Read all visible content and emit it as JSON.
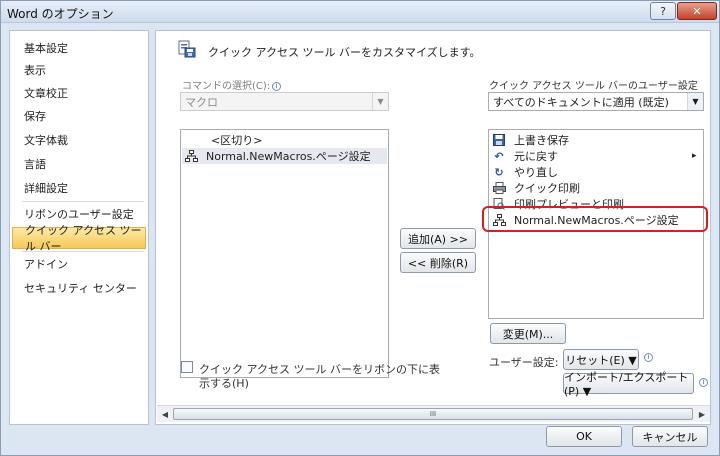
{
  "window": {
    "title": "Word のオプション",
    "help_button": "?",
    "close_button": "✕"
  },
  "nav": {
    "items": [
      {
        "label": "基本設定"
      },
      {
        "label": "表示"
      },
      {
        "label": "文章校正"
      },
      {
        "label": "保存"
      },
      {
        "label": "文字体裁"
      },
      {
        "label": "言語"
      },
      {
        "label": "詳細設定"
      },
      {
        "label": "リボンのユーザー設定"
      },
      {
        "label": "クイック アクセス ツール バー",
        "selected": true
      },
      {
        "label": "アドイン"
      },
      {
        "label": "セキュリティ センター"
      }
    ]
  },
  "main": {
    "header": "クイック アクセス ツール バーをカスタマイズします。",
    "choose_commands_label": "コマンドの選択(C):",
    "choose_commands_value": "マクロ",
    "qat_customize_label": "クイック アクセス ツール バーのユーザー設定(Q):",
    "qat_customize_value": "すべてのドキュメントに適用 (既定)",
    "available_commands": [
      {
        "label": "<区切り>",
        "icon": ""
      },
      {
        "label": "Normal.NewMacros.ページ設定",
        "icon": "macro-icon",
        "selected": true
      }
    ],
    "qat_commands": [
      {
        "label": "上書き保存",
        "icon": "save-icon"
      },
      {
        "label": "元に戻す",
        "icon": "undo-icon",
        "submenu": "▸"
      },
      {
        "label": "やり直し",
        "icon": "redo-icon"
      },
      {
        "label": "クイック印刷",
        "icon": "print-icon"
      },
      {
        "label": "印刷プレビューと印刷",
        "icon": "print-preview-icon"
      },
      {
        "label": "Normal.NewMacros.ページ設定",
        "icon": "macro-icon"
      }
    ],
    "add_button": "追加(A) >>",
    "remove_button": "<< 削除(R)",
    "modify_button": "変更(M)...",
    "customizations_label": "ユーザー設定:",
    "reset_button": "リセット(E) ▼",
    "import_export_button": "インポート/エクスポート(P) ▼",
    "show_below_ribbon_line1": "クイック アクセス ツール バーをリボンの下に表",
    "show_below_ribbon_line2": "示する(H)",
    "scroll_grip": "III"
  },
  "footer": {
    "ok_button": "OK",
    "cancel_button": "キャンセル"
  },
  "colors": {
    "selected_nav_bg": "#f7c859",
    "highlight_ring": "#d62020",
    "window_bg": "#dce6f2"
  }
}
